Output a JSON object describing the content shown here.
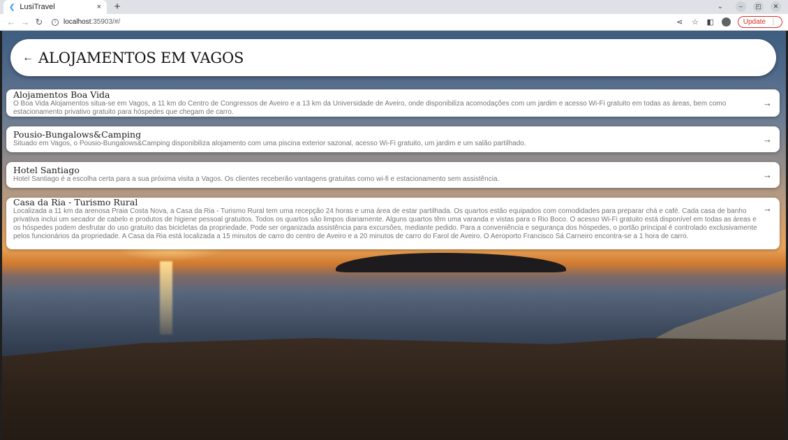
{
  "browser": {
    "tab_title": "LusiTravel",
    "tab_close": "×",
    "new_tab": "+",
    "url_host": "localhost",
    "url_path": ":35903/#/",
    "update_label": "Update",
    "dropdown_glyph": "⌄",
    "minimize_glyph": "–",
    "maximize_glyph": "◰",
    "close_glyph": "✕"
  },
  "page": {
    "title": "ALOJAMENTOS EM VAGOS",
    "back_glyph": "←"
  },
  "listings": [
    {
      "name": "Alojamentos Boa Vida",
      "description": "O Boa Vida Alojamentos situa-se em Vagos, a 11 km do Centro de Congressos de Aveiro e a 13 km da Universidade de Aveiro, onde disponibiliza acomodações com um jardim e acesso Wi-Fi gratuito em todas as áreas, bem como estacionamento privativo gratuito para hóspedes que chegam de carro."
    },
    {
      "name": "Pousio-Bungalows&Camping",
      "description": "Situado em Vagos, o Pousio-Bungalows&Camping disponibiliza alojamento com uma piscina exterior sazonal, acesso Wi-Fi gratuito, um jardim e um salão partilhado."
    },
    {
      "name": "Hotel Santiago",
      "description": "Hotel Santiago é a escolha certa para a sua próxima visita a Vagos. Os clientes receberão vantagens gratuitas como wi-fi e estacionamento sem assistência."
    },
    {
      "name": "Casa da Ria - Turismo Rural",
      "description": "Localizada a 11 km da arenosa Praia Costa Nova, a Casa da Ria - Turismo Rural tem uma recepção 24 horas e uma área de estar partilhada. Os quartos estão equipados com comodidades para preparar chá e café. Cada casa de banho privativa inclui um secador de cabelo e produtos de higiene pessoal gratuitos. Todos os quartos são limpos diariamente. Alguns quartos têm uma varanda e vistas para o Rio Boco.  O acesso Wi-Fi gratuito está disponível em todas as áreas e os hóspedes podem desfrutar do uso gratuito das bicicletas da propriedade. Pode ser organizada assistência para excursões, mediante pedido.  Para a conveniência e segurança dos hóspedes, o portão principal é controlado exclusivamente pelos funcionários da propriedade.  A Casa da Ria está localizada a 15 minutos de carro do centro de Aveiro e a 20 minutos de carro do Farol de Aveiro. O Aeroporto Francisco Sá Carneiro encontra-se a 1 hora de carro."
    }
  ],
  "icons": {
    "arrow": "→"
  }
}
